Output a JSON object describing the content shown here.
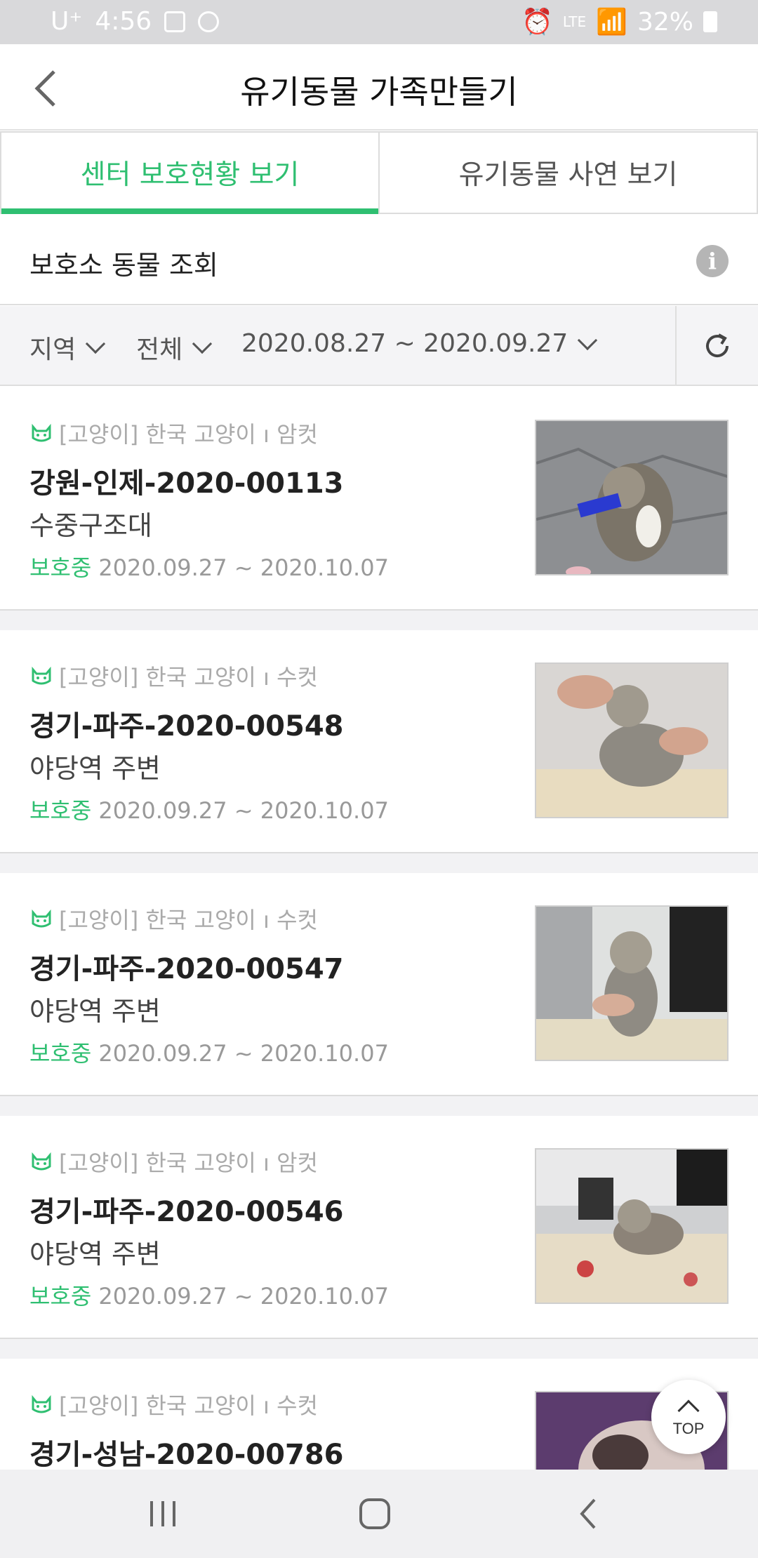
{
  "status_bar": {
    "carrier": "U⁺",
    "time": "4:56",
    "network": "LTE",
    "battery": "32%"
  },
  "header": {
    "title": "유기동물 가족만들기"
  },
  "tabs": [
    {
      "label": "센터 보호현황 보기",
      "active": true
    },
    {
      "label": "유기동물 사연 보기",
      "active": false
    }
  ],
  "section": {
    "title": "보호소 동물 조회"
  },
  "filters": {
    "region": "지역",
    "type": "전체",
    "date_range": "2020.08.27 ~ 2020.09.27"
  },
  "animals": [
    {
      "meta": "[고양이] 한국 고양이 ı 암컷",
      "case_no": "강원-인제-2020-00113",
      "place": "수중구조대",
      "status": "보호중",
      "period": "2020.09.27 ~ 2020.10.07"
    },
    {
      "meta": "[고양이] 한국 고양이 ı 수컷",
      "case_no": "경기-파주-2020-00548",
      "place": "야당역 주변",
      "status": "보호중",
      "period": "2020.09.27 ~ 2020.10.07"
    },
    {
      "meta": "[고양이] 한국 고양이 ı 수컷",
      "case_no": "경기-파주-2020-00547",
      "place": "야당역 주변",
      "status": "보호중",
      "period": "2020.09.27 ~ 2020.10.07"
    },
    {
      "meta": "[고양이] 한국 고양이 ı 암컷",
      "case_no": "경기-파주-2020-00546",
      "place": "야당역 주변",
      "status": "보호중",
      "period": "2020.09.27 ~ 2020.10.07"
    },
    {
      "meta": "[고양이] 한국 고양이 ı 수컷",
      "case_no": "경기-성남-2020-00786",
      "place": "",
      "status": "",
      "period": ""
    }
  ],
  "top_button": {
    "label": "TOP"
  },
  "colors": {
    "accent": "#2fbf71",
    "muted": "#aaaaaa"
  }
}
